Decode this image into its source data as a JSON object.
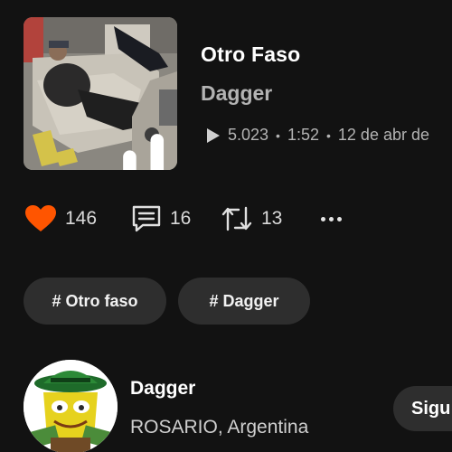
{
  "track": {
    "title": "Otro Faso",
    "artist": "Dagger",
    "plays": "5.023",
    "duration": "1:52",
    "date": "12 de abr de"
  },
  "actions": {
    "likes": "146",
    "comments": "16",
    "reposts": "13",
    "like_color": "#ff5500"
  },
  "tags": [
    "# Otro faso",
    "# Dagger"
  ],
  "user": {
    "name": "Dagger",
    "location": "ROSARIO, Argentina",
    "follow_label": "Sigu"
  },
  "icons": {
    "artwork_overlay": "waveform-icon",
    "play": "play-icon",
    "like": "heart-icon",
    "comment": "comment-icon",
    "repost": "repost-icon",
    "more": "more-icon"
  }
}
